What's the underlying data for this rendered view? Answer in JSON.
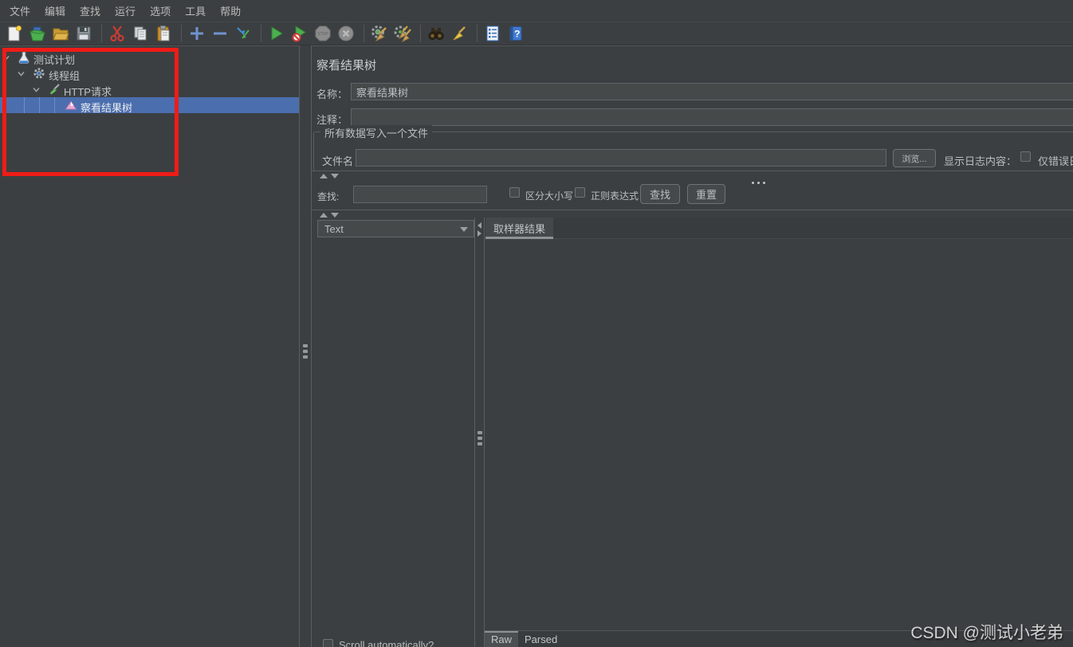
{
  "menu_bar": {
    "items": [
      "文件",
      "编辑",
      "查找",
      "运行",
      "选项",
      "工具",
      "帮助"
    ]
  },
  "toolbar": {
    "icon_names": [
      "new-file",
      "templates",
      "open-file",
      "save",
      "cut",
      "copy",
      "paste",
      "expand",
      "collapse",
      "toggle",
      "start",
      "start-no-pauses",
      "stop",
      "shutdown",
      "clear",
      "clear-all",
      "search",
      "reset-search",
      "function-helper",
      "help"
    ],
    "stop_label": "STOP",
    "help_glyph": "?"
  },
  "tree": {
    "items": [
      {
        "label": "测试计划",
        "icon": "test-plan-flask-icon"
      },
      {
        "label": "线程组",
        "icon": "thread-group-gear-icon"
      },
      {
        "label": "HTTP请求",
        "icon": "http-request-sampler-icon"
      },
      {
        "label": "察看结果树",
        "icon": "view-results-tree-icon",
        "selected": true
      }
    ]
  },
  "main": {
    "title": "察看结果树",
    "name_label": "名称：",
    "name_value": "察看结果树",
    "comment_label": "注释：",
    "comment_value": "",
    "file_group": {
      "title": "所有数据写入一个文件",
      "filename_label": "文件名",
      "filename_value": "",
      "browse_button": "浏览...",
      "display_log_label": "显示日志内容：",
      "errors_only_label": "仅错误日志"
    },
    "search": {
      "label": "查找:",
      "value": "",
      "case_label": "区分大小写",
      "regex_label": "正则表达式",
      "search_button": "查找",
      "reset_button": "重置"
    },
    "viewer": {
      "format_value": "Text",
      "result_tab": "取样器结果",
      "scroll_label": "Scroll automatically?",
      "raw_tab": "Raw",
      "parsed_tab": "Parsed"
    }
  },
  "watermark": "CSDN @测试小老弟",
  "colors": {
    "background": "#3c3f41",
    "selection": "#4b6eaf",
    "annotation_red": "#ef1c17",
    "input_bg": "#45494a",
    "text": "#bbbbbb"
  }
}
